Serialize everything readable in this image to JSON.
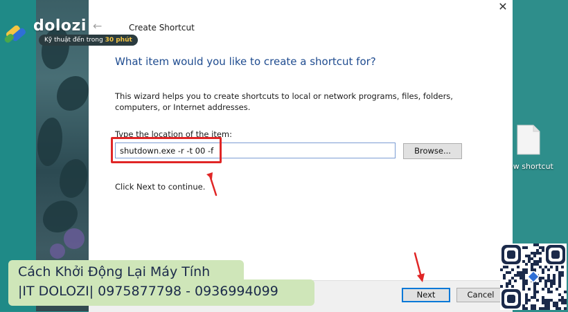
{
  "dialog": {
    "title": "Create Shortcut",
    "close_glyph": "✕",
    "back_glyph": "←",
    "heading": "What item would you like to create a shortcut for?",
    "description": "This wizard helps you to create shortcuts to local or network programs, files, folders, computers, or Internet addresses.",
    "location_label": "Type the location of the item:",
    "location_value": "shutdown.exe -r -t 00 -f",
    "browse_label": "Browse...",
    "hint": "Click Next to continue.",
    "next_label": "Next",
    "cancel_label": "Cancel"
  },
  "desktop": {
    "file_label": "ew shortcut"
  },
  "watermark": {
    "brand": "dolozi",
    "tagline_prefix": "Kỹ thuật đến trong",
    "tagline_highlight": "30 phút"
  },
  "banner": {
    "line1": "Cách Khởi Động Lại Máy Tính",
    "line2": "|IT  DOLOZI| 0975877798 - 0936994099"
  },
  "colors": {
    "heading": "#1e4b8f",
    "annotation": "#e02626",
    "accent": "#0078d7",
    "desktop": "#2b8f8c",
    "banner": "#cfe6b9"
  },
  "icons": {
    "close": "close-icon",
    "back": "back-arrow-icon",
    "file": "file-icon",
    "logo": "dolozi-logo-icon",
    "qr": "qr-code"
  }
}
